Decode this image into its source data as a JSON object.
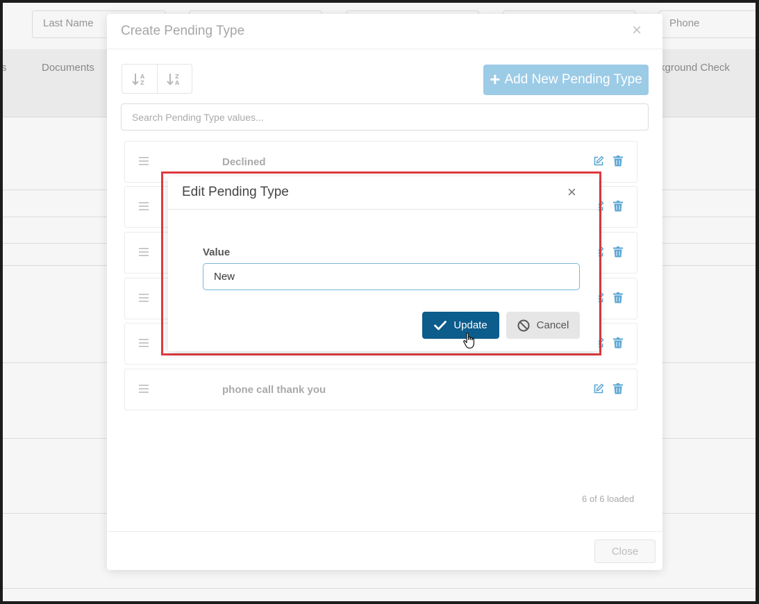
{
  "background": {
    "filters": [
      "Last Name",
      "Phone"
    ],
    "columns": [
      "s",
      "Documents",
      "kground Check"
    ]
  },
  "modal": {
    "title": "Create Pending Type",
    "close_glyph": "×",
    "sort_asc_icon": "sort-alpha-asc-icon",
    "sort_desc_icon": "sort-alpha-desc-icon",
    "add_button": {
      "plus": "+",
      "label": "Add New Pending Type"
    },
    "search_placeholder": "Search Pending Type values...",
    "items": [
      {
        "label": "Declined"
      },
      {
        "label": ""
      },
      {
        "label": ""
      },
      {
        "label": ""
      },
      {
        "label": ""
      },
      {
        "label": "phone call thank you"
      }
    ],
    "loaded_text": "6 of 6 loaded",
    "close_button": "Close"
  },
  "dialog": {
    "title": "Edit Pending Type",
    "close_glyph": "×",
    "field_label": "Value",
    "field_value": "New",
    "update_button": "Update",
    "cancel_button": "Cancel"
  },
  "colors": {
    "primary": "#0c5c8c",
    "add_button": "#9ccbe6",
    "icon_blue": "#5aa6d3",
    "highlight": "#e03a3e"
  }
}
